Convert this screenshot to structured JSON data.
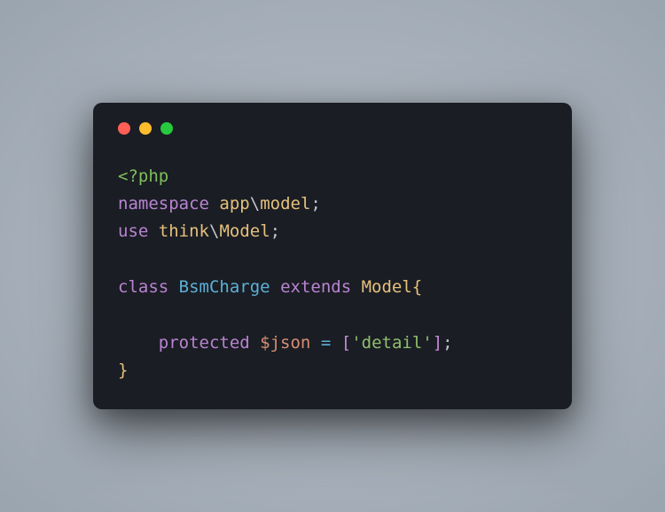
{
  "window": {
    "controls": {
      "close": "close",
      "minimize": "minimize",
      "maximize": "maximize"
    }
  },
  "code": {
    "open_tag": "<?php",
    "kw_namespace": "namespace",
    "ns_app": "app",
    "ns_model": "model",
    "kw_use": "use",
    "use_think": "think",
    "use_Model": "Model",
    "kw_class": "class",
    "class_name": "BsmCharge",
    "kw_extends": "extends",
    "parent_class": "Model",
    "kw_protected": "protected",
    "var_json": "$json",
    "op_assign": "=",
    "str_detail": "'detail'",
    "backslash": "\\",
    "semicolon": ";",
    "brace_open": "{",
    "brace_close": "}",
    "bracket_open": "[",
    "bracket_close": "]"
  }
}
